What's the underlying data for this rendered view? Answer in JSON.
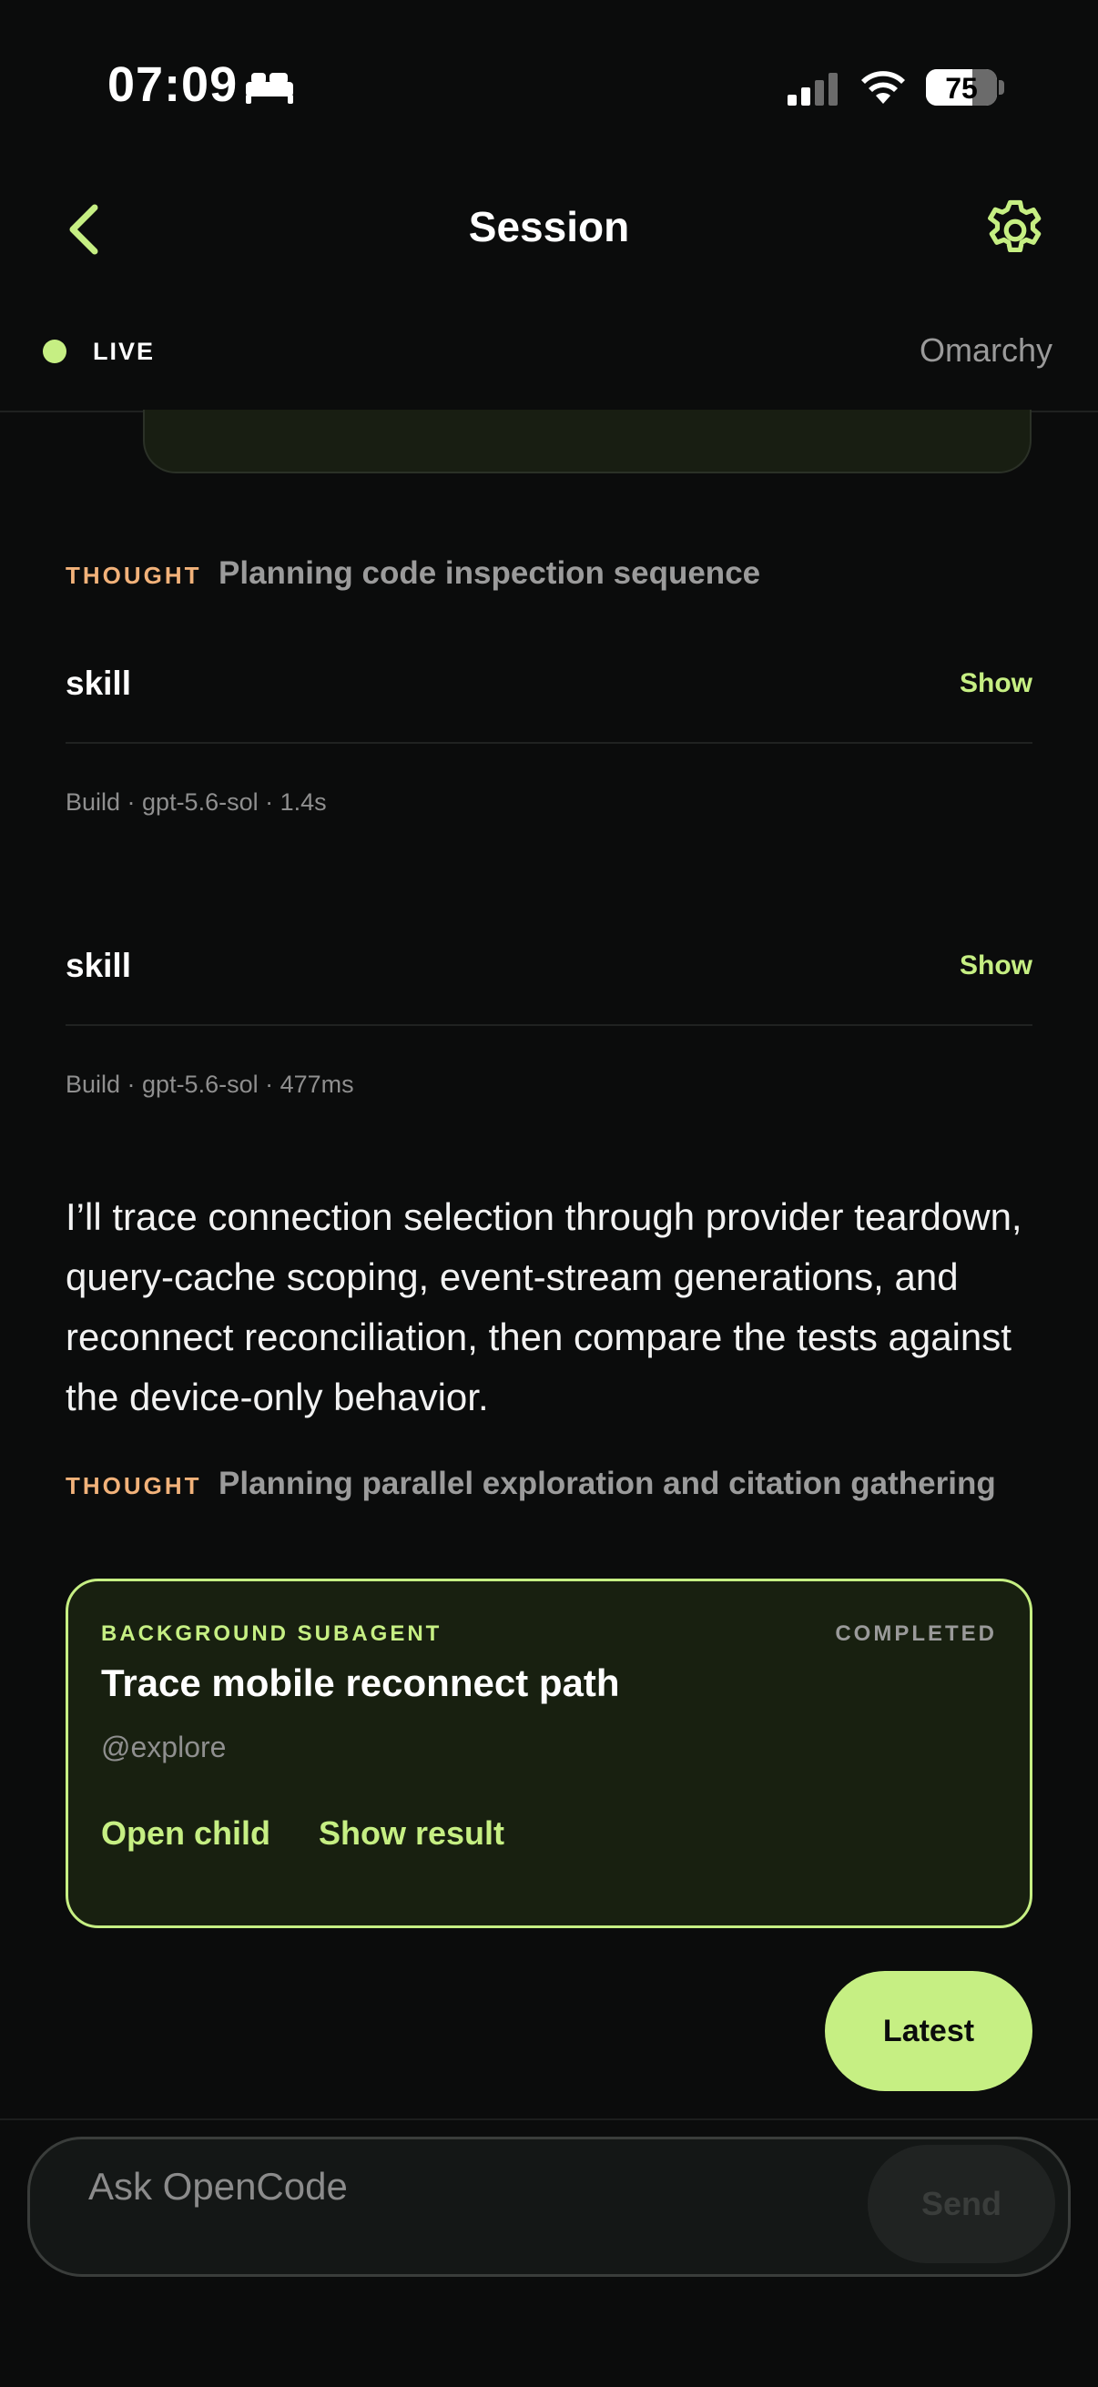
{
  "status_bar": {
    "time": "07:09",
    "battery": "75",
    "icons": [
      "bed-icon",
      "cellular-signal-icon",
      "wifi-icon",
      "battery-icon"
    ]
  },
  "header": {
    "title": "Session",
    "back_icon": "chevron-left-icon",
    "settings_icon": "gear-icon"
  },
  "connection": {
    "status": "LIVE",
    "device": "Omarchy"
  },
  "feed": {
    "thought1": {
      "tag": "THOUGHT",
      "text": "Planning code inspection sequence"
    },
    "tool1": {
      "name": "skill",
      "action": "Show",
      "meta": "Build · gpt-5.6-sol · 1.4s"
    },
    "tool2": {
      "name": "skill",
      "action": "Show",
      "meta": "Build · gpt-5.6-sol · 477ms"
    },
    "message": "I’ll trace connection selection through provider teardown, query-cache scoping, event-stream generations, and reconnect reconciliation, then compare the tests against the device-only behavior.",
    "thought2": {
      "tag": "THOUGHT",
      "text": "Planning parallel exploration and citation gathering"
    },
    "subagent": {
      "tag": "BACKGROUND SUBAGENT",
      "status": "COMPLETED",
      "title": "Trace mobile reconnect path",
      "agent": "@explore",
      "open_label": "Open child",
      "result_label": "Show result"
    }
  },
  "latest_button": "Latest",
  "composer": {
    "placeholder": "Ask OpenCode",
    "value": "",
    "send_label": "Send"
  },
  "colors": {
    "accent": "#c6ef83",
    "thought": "#f2b27a",
    "background": "#0b0c0c"
  }
}
